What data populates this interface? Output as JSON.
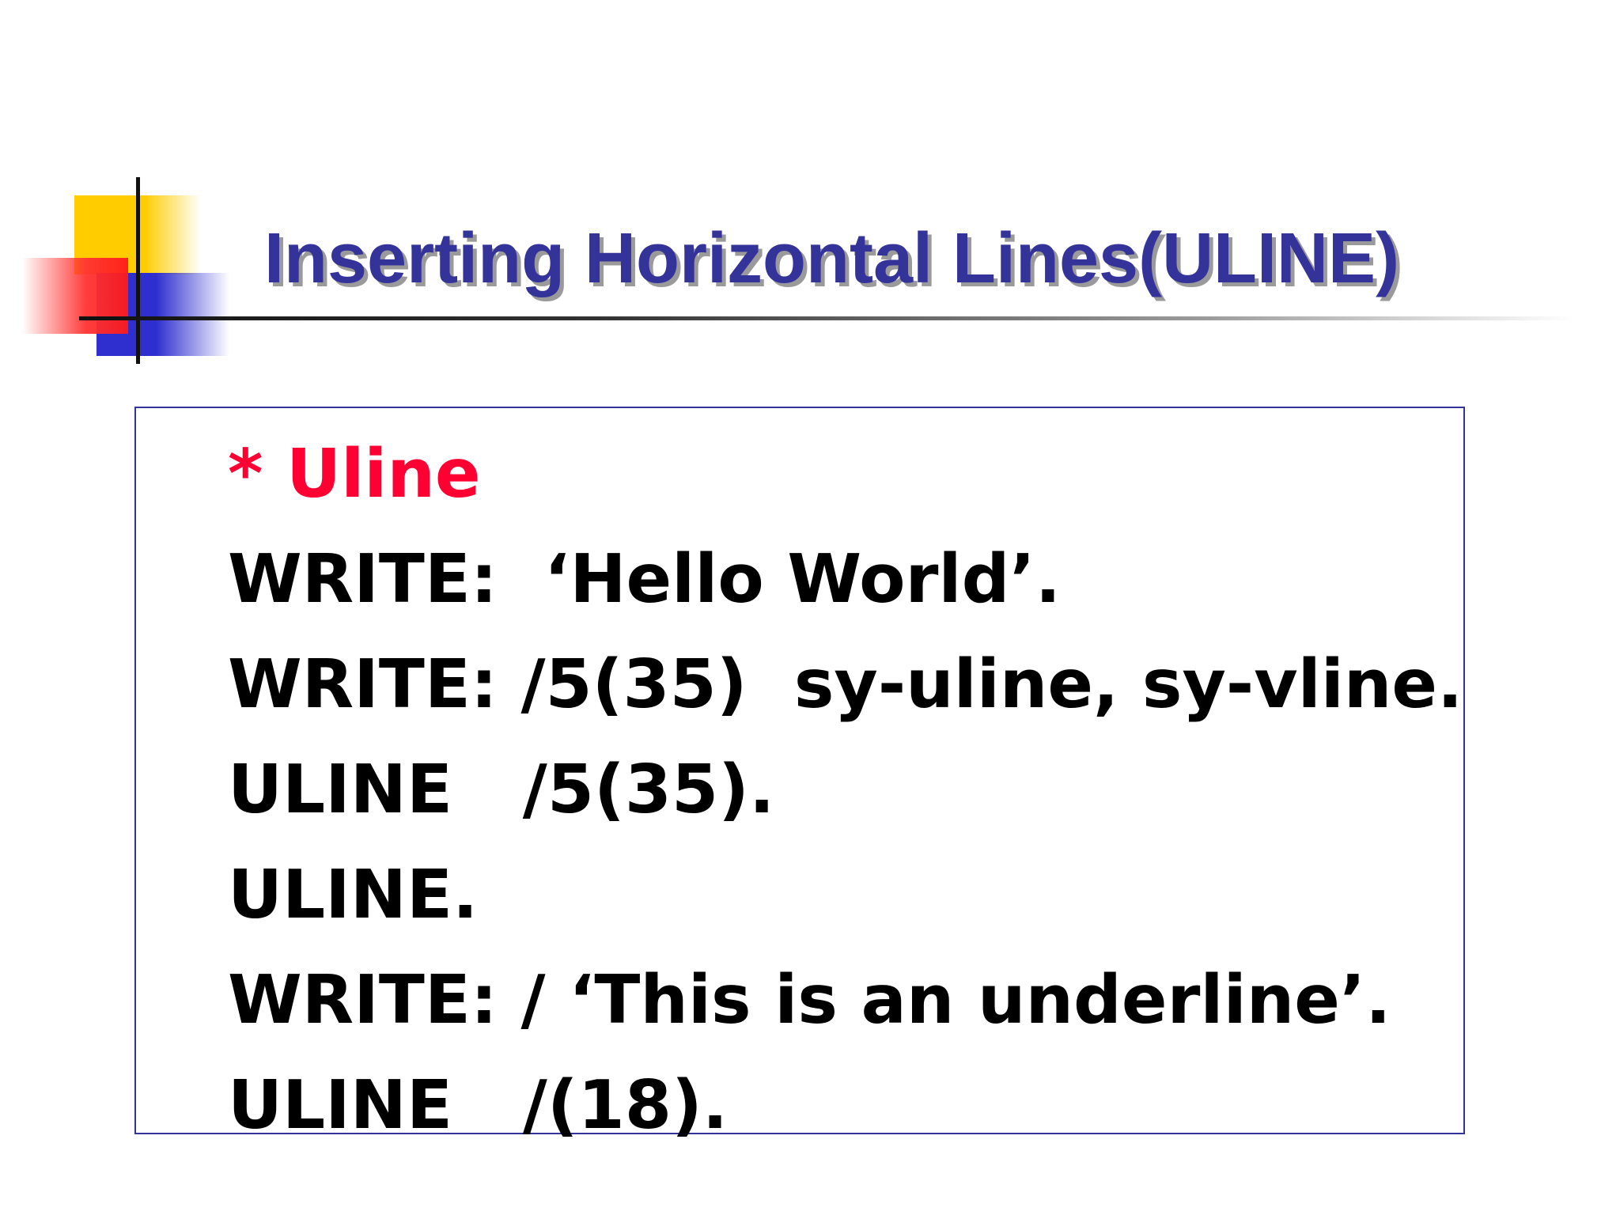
{
  "slide": {
    "title": "Inserting Horizontal Lines(ULINE)",
    "code_lines": [
      "* Uline",
      "WRITE:  ‘Hello World’.",
      "WRITE: /5(35)  sy-uline, sy-vline.",
      "ULINE   /5(35).",
      "ULINE.",
      "WRITE: / ‘This is an underline’.",
      "ULINE   /(18)."
    ]
  },
  "colors": {
    "title": "#333399",
    "title_shadow": "#9a9a9a",
    "comment": "#ff0033",
    "code": "#000000",
    "box_border": "#333399",
    "deco_yellow": "#ffcc00",
    "deco_red": "#ff1a1a",
    "deco_blue": "#2f2fcf"
  }
}
